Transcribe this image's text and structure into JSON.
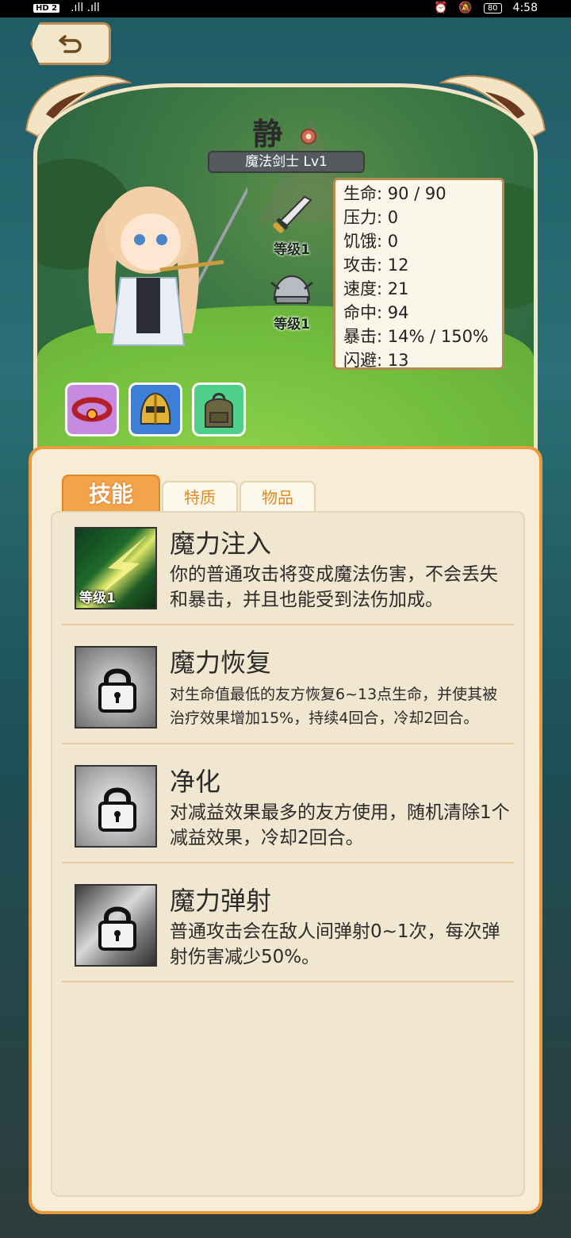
{
  "status_bar": {
    "hd": "HD 2",
    "signal": "4G .ıl ıl",
    "time": "4:58",
    "battery": "80"
  },
  "character": {
    "name": "静",
    "class_level": "魔法剑士 Lv1"
  },
  "equipment": [
    {
      "icon": "sword-icon",
      "level": "等级1"
    },
    {
      "icon": "helmet-icon",
      "level": "等级1"
    }
  ],
  "stats": [
    {
      "label": "生命",
      "value": "90 / 90"
    },
    {
      "label": "压力",
      "value": "0"
    },
    {
      "label": "饥饿",
      "value": "0"
    },
    {
      "label": "攻击",
      "value": "12"
    },
    {
      "label": "速度",
      "value": "21"
    },
    {
      "label": "命中",
      "value": "94"
    },
    {
      "label": "暴击",
      "value": "14% / 150%"
    },
    {
      "label": "闪避",
      "value": "13"
    }
  ],
  "stat_lines": [
    "生命: 90 / 90",
    "压力: 0",
    "饥饿: 0",
    "攻击: 12",
    "速度: 21",
    "命中: 94",
    "暴击: 14% / 150%",
    "闪避: 13"
  ],
  "items": [
    {
      "icon": "red-amulet-icon",
      "color": "#c68ae0"
    },
    {
      "icon": "golden-helmet-icon",
      "color": "#3d7fd8"
    },
    {
      "icon": "backpack-icon",
      "color": "#4fd08a"
    }
  ],
  "tabs": [
    {
      "label": "技能",
      "active": true
    },
    {
      "label": "特质",
      "active": false
    },
    {
      "label": "物品",
      "active": false
    }
  ],
  "skills": [
    {
      "name": "魔力注入",
      "description": "你的普通攻击将变成魔法伤害，不会丢失和暴击，并且也能受到法伤加成。",
      "level": "等级1",
      "locked": false
    },
    {
      "name": "魔力恢复",
      "description": "对生命值最低的友方恢复6~13点生命，并使其被治疗效果增加15%，持续4回合，冷却2回合。",
      "locked": true
    },
    {
      "name": "净化",
      "description": "对减益效果最多的友方使用，随机清除1个减益效果，冷却2回合。",
      "locked": true
    },
    {
      "name": "魔力弹射",
      "description": "普通攻击会在敌人间弹射0~1次，每次弹射伤害减少50%。",
      "locked": true
    }
  ],
  "colors": {
    "accent": "#f3a34a",
    "panel": "#f7ecd5",
    "border": "#e89a3c"
  }
}
